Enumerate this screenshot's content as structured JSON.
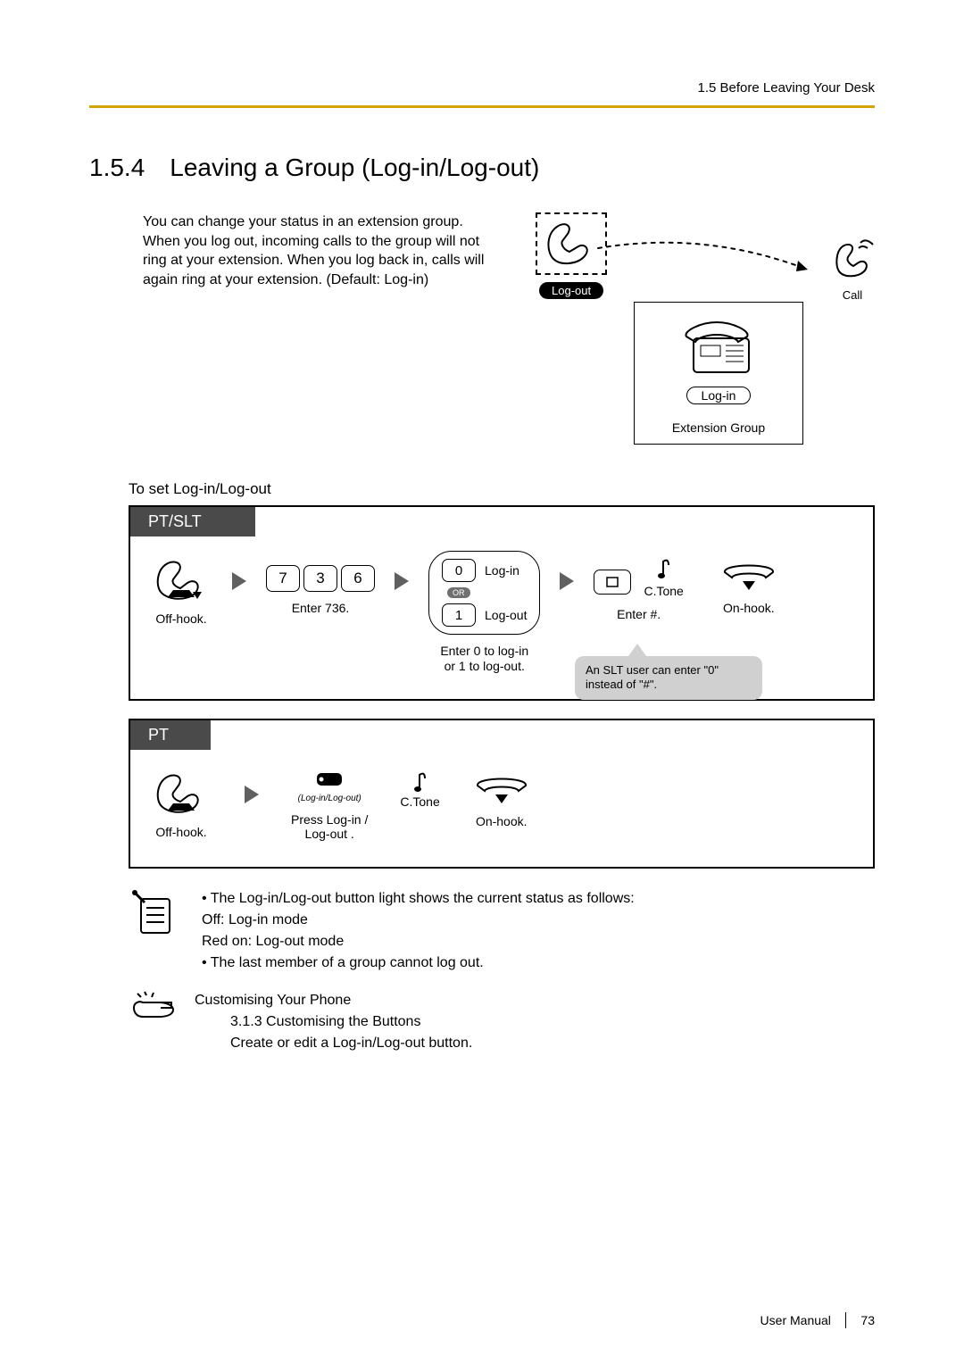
{
  "header": {
    "path": "1.5 Before Leaving Your Desk"
  },
  "section": {
    "number": "1.5.4",
    "title": "Leaving a Group (Log-in/Log-out)"
  },
  "intro": "You can change your status in an extension group. When you log out, incoming calls to the group will not ring at your extension. When you log back in, calls will again ring at your extension. (Default: Log-in)",
  "diagram": {
    "logout": "Log-out",
    "login": "Log-in",
    "extgroup": "Extension Group",
    "call": "Call"
  },
  "subheading": "To set Log-in/Log-out",
  "proc1": {
    "label": "PT/SLT",
    "step1": "Off-hook.",
    "keys": [
      "7",
      "3",
      "6"
    ],
    "step2": "Enter 736.",
    "opt0": "0",
    "opt0label": "Log-in",
    "or": "OR",
    "opt1": "1",
    "opt1label": "Log-out",
    "step3a": "Enter 0 to log-in",
    "step3b": "or 1 to log-out.",
    "hash_icon": "#",
    "ctone": "C.Tone",
    "step4": "Enter #.",
    "step5": "On-hook.",
    "note": "An SLT user can enter \"0\" instead of \"#\"."
  },
  "proc2": {
    "label": "PT",
    "step1": "Off-hook.",
    "btn_caption": "(Log-in/Log-out)",
    "step2a": "Press Log-in /",
    "step2b": "Log-out .",
    "ctone": "C.Tone",
    "step3": "On-hook."
  },
  "bullets": {
    "l1": "The Log-in/Log-out button light shows the current status as follows:",
    "l2": "Off: Log-in mode",
    "l3": "Red on: Log-out mode",
    "l4": "The last member of a group cannot log out."
  },
  "custom": {
    "heading": "Customising Your Phone",
    "ref": "3.1.3 Customising the Buttons",
    "desc": "Create or edit a Log-in/Log-out button."
  },
  "footer": {
    "label": "User Manual",
    "page": "73"
  }
}
